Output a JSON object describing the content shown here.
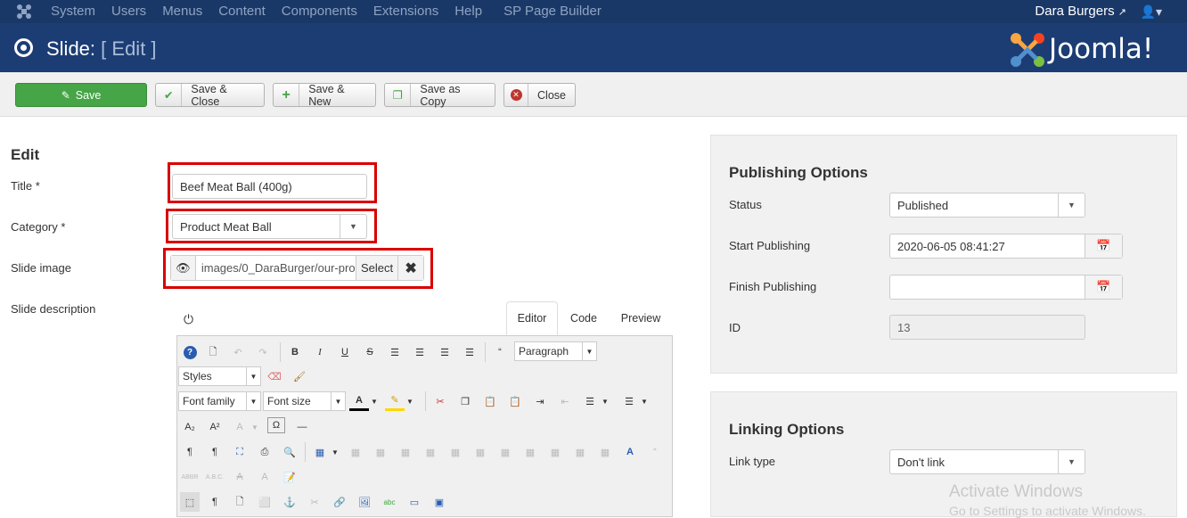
{
  "topnav": {
    "menu": [
      "System",
      "Users",
      "Menus",
      "Content",
      "Components",
      "Extensions",
      "Help",
      "SP Page Builder"
    ],
    "user": "Dara Burgers",
    "external_icon": "external-link-icon",
    "user_icon": "user-icon"
  },
  "header": {
    "title": "Slide:",
    "subtitle": "[ Edit ]",
    "brand": "Joomla!"
  },
  "toolbar": {
    "save": "Save",
    "save_close": "Save & Close",
    "save_new": "Save & New",
    "save_copy": "Save as Copy",
    "close": "Close"
  },
  "form": {
    "heading": "Edit",
    "title_label": "Title *",
    "title_value": "Beef Meat Ball (400g)",
    "category_label": "Category *",
    "category_value": "Product Meat Ball",
    "image_label": "Slide image",
    "image_value": "images/0_DaraBurger/our-pro",
    "image_select": "Select",
    "description_label": "Slide description"
  },
  "editor": {
    "tabs": [
      "Editor",
      "Code",
      "Preview"
    ],
    "format_select": "Paragraph",
    "styles_select": "Styles",
    "font_family": "Font family",
    "font_size": "Font size"
  },
  "publishing": {
    "heading": "Publishing Options",
    "status_label": "Status",
    "status_value": "Published",
    "start_label": "Start Publishing",
    "start_value": "2020-06-05 08:41:27",
    "finish_label": "Finish Publishing",
    "finish_value": "",
    "id_label": "ID",
    "id_value": "13"
  },
  "linking": {
    "heading": "Linking Options",
    "type_label": "Link type",
    "type_value": "Don't link"
  },
  "watermark": {
    "line1": "Activate Windows",
    "line2": "Go to Settings to activate Windows."
  },
  "colors": {
    "topnav": "#1a3867",
    "header": "#1c3d74",
    "save_green": "#46a546",
    "highlight_red": "#d90000"
  }
}
